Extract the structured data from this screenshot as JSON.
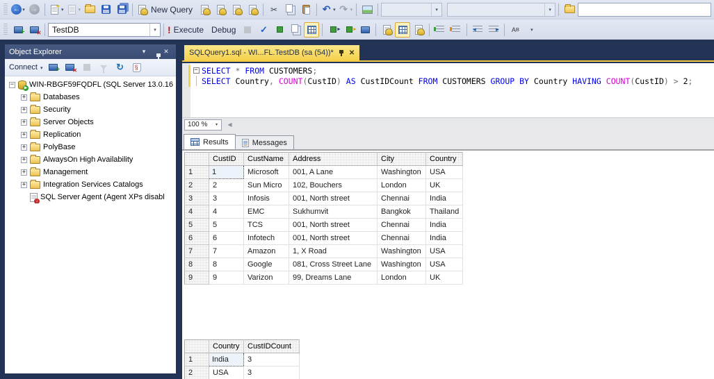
{
  "icons": {
    "back": "←",
    "forward": "→",
    "caret": "▾",
    "scissors": "✂",
    "undo": "↶",
    "redo": "↷",
    "check": "✓",
    "bang": "!",
    "refresh": "↻",
    "close": "✕",
    "minus": "−",
    "left_arrow": "◀"
  },
  "toolbar_main": {
    "new_query_label": "New Query",
    "search_value": ""
  },
  "toolbar_sql": {
    "database_value": "TestDB",
    "execute_label": "Execute",
    "debug_label": "Debug"
  },
  "object_explorer": {
    "title": "Object Explorer",
    "connect_label": "Connect",
    "tree": [
      {
        "label": "WIN-RBGF59FQDFL (SQL Server 13.0.16",
        "icon": "server",
        "expander": "minus",
        "indent": 0
      },
      {
        "label": "Databases",
        "icon": "folder",
        "expander": "plus",
        "indent": 1
      },
      {
        "label": "Security",
        "icon": "folder",
        "expander": "plus",
        "indent": 1
      },
      {
        "label": "Server Objects",
        "icon": "folder",
        "expander": "plus",
        "indent": 1
      },
      {
        "label": "Replication",
        "icon": "folder",
        "expander": "plus",
        "indent": 1
      },
      {
        "label": "PolyBase",
        "icon": "folder",
        "expander": "plus",
        "indent": 1
      },
      {
        "label": "AlwaysOn High Availability",
        "icon": "folder",
        "expander": "plus",
        "indent": 1
      },
      {
        "label": "Management",
        "icon": "folder",
        "expander": "plus",
        "indent": 1
      },
      {
        "label": "Integration Services Catalogs",
        "icon": "folder",
        "expander": "plus",
        "indent": 1
      },
      {
        "label": "SQL Server Agent (Agent XPs disabl",
        "icon": "agent",
        "expander": "none",
        "indent": 1
      }
    ]
  },
  "editor": {
    "tab_title": "SQLQuery1.sql - WI...FL.TestDB (sa (54))*",
    "zoom_value": "100 %",
    "code_lines": [
      {
        "collapsible": true,
        "tokens": [
          [
            "SELECT",
            "kw"
          ],
          [
            " ",
            "pl"
          ],
          [
            "*",
            "op"
          ],
          [
            " ",
            "pl"
          ],
          [
            "FROM",
            "kw"
          ],
          [
            " CUSTOMERS",
            "pl"
          ],
          [
            ";",
            "op"
          ]
        ]
      },
      {
        "collapsible": false,
        "tokens": [
          [
            "SELECT",
            "kw"
          ],
          [
            " Country",
            "pl"
          ],
          [
            ",",
            "op"
          ],
          [
            " ",
            "pl"
          ],
          [
            "COUNT",
            "fn"
          ],
          [
            "(",
            "op"
          ],
          [
            "CustID",
            "pl"
          ],
          [
            ")",
            "op"
          ],
          [
            " ",
            "pl"
          ],
          [
            "AS",
            "kw"
          ],
          [
            " CustIDCount ",
            "pl"
          ],
          [
            "FROM",
            "kw"
          ],
          [
            " CUSTOMERS ",
            "pl"
          ],
          [
            "GROUP",
            "kw"
          ],
          [
            " ",
            "pl"
          ],
          [
            "BY",
            "kw"
          ],
          [
            " Country ",
            "pl"
          ],
          [
            "HAVING",
            "kw"
          ],
          [
            " ",
            "pl"
          ],
          [
            "COUNT",
            "fn"
          ],
          [
            "(",
            "op"
          ],
          [
            "CustID",
            "pl"
          ],
          [
            ")",
            "op"
          ],
          [
            " ",
            "pl"
          ],
          [
            ">",
            "op"
          ],
          [
            " 2",
            "pl"
          ],
          [
            ";",
            "op"
          ]
        ]
      }
    ]
  },
  "results": {
    "tab_results": "Results",
    "tab_messages": "Messages",
    "grid1": {
      "columns": [
        "",
        "CustID",
        "CustName",
        "Address",
        "City",
        "Country"
      ],
      "rows": [
        [
          "1",
          "1",
          "Microsoft",
          "001, A Lane",
          "Washington",
          "USA"
        ],
        [
          "2",
          "2",
          "Sun Micro",
          "102, Bouchers",
          "London",
          "UK"
        ],
        [
          "3",
          "3",
          "Infosis",
          "001, North street",
          "Chennai",
          "India"
        ],
        [
          "4",
          "4",
          "EMC",
          "Sukhumvit",
          "Bangkok",
          "Thailand"
        ],
        [
          "5",
          "5",
          "TCS",
          "001, North street",
          "Chennai",
          "India"
        ],
        [
          "6",
          "6",
          "Infotech",
          "001, North street",
          "Chennai",
          "India"
        ],
        [
          "7",
          "7",
          "Amazon",
          "1, X Road",
          "Washington",
          "USA"
        ],
        [
          "8",
          "8",
          "Google",
          "081, Cross Street Lane",
          "Washington",
          "USA"
        ],
        [
          "9",
          "9",
          "Varizon",
          "99, Dreams Lane",
          "London",
          "UK"
        ]
      ],
      "selected_cell": {
        "row": 0,
        "col": 1
      }
    },
    "grid2": {
      "columns": [
        "",
        "Country",
        "CustIDCount"
      ],
      "rows": [
        [
          "1",
          "India",
          "3"
        ],
        [
          "2",
          "USA",
          "3"
        ]
      ],
      "selected_cell": {
        "row": 0,
        "col": 1
      }
    }
  }
}
